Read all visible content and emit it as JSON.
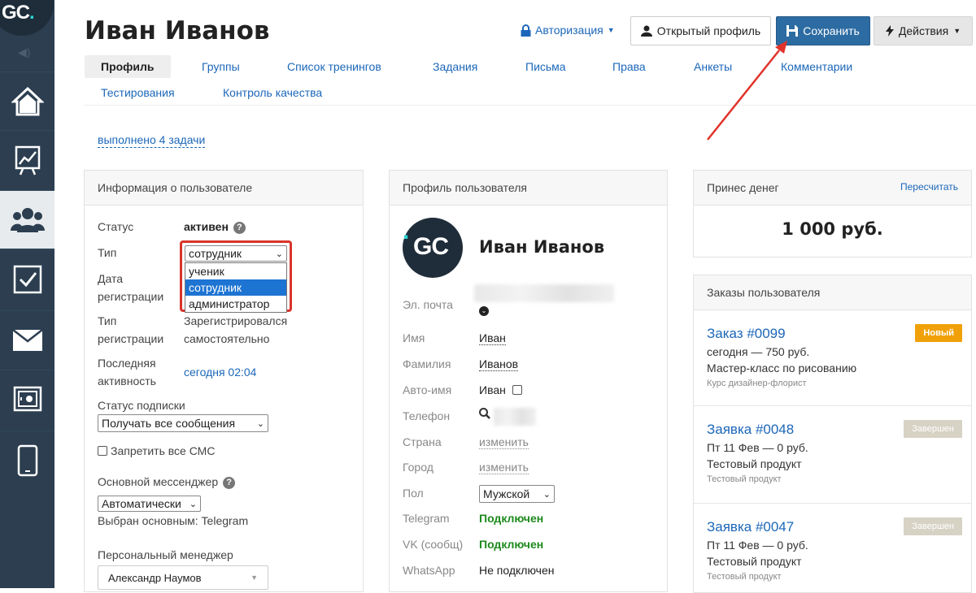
{
  "logo": {
    "text_g": "GC",
    "text_dot": "."
  },
  "header": {
    "title": "Иван Иванов",
    "auth_label": "Авторизация",
    "open_profile_label": "Открытый профиль",
    "save_label": "Сохранить",
    "actions_label": "Действия"
  },
  "tabs": [
    "Профиль",
    "Группы",
    "Список тренингов",
    "Задания",
    "Письма",
    "Права",
    "Анкеты",
    "Комментарии",
    "Тестирования",
    "Контроль качества"
  ],
  "tasks_done_link": "выполнено 4 задачи",
  "user_info": {
    "heading": "Информация о пользователе",
    "status_label": "Статус",
    "status_value": "активен",
    "type_label": "Тип",
    "type_value": "сотрудник",
    "type_options": [
      "ученик",
      "сотрудник",
      "администратор"
    ],
    "reg_date_label_1": "Дата",
    "reg_date_label_2": "регистрации",
    "reg_type_label_1": "Тип",
    "reg_type_label_2": "регистрации",
    "reg_type_value_1": "Зарегистрировался",
    "reg_type_value_2": "самостоятельно",
    "last_activity_label_1": "Последняя",
    "last_activity_label_2": "активность",
    "last_activity_value": "сегодня 02:04",
    "subscription_label": "Статус подписки",
    "subscription_value": "Получать все сообщения",
    "ban_sms_label": "Запретить все СМС",
    "messenger_label": "Основной мессенджер",
    "messenger_value": "Автоматически",
    "messenger_selected": "Выбран основным: Telegram",
    "manager_label": "Персональный менеджер",
    "manager_value": "Александр Наумов"
  },
  "profile": {
    "heading": "Профиль пользователя",
    "name": "Иван Иванов",
    "email_label": "Эл. почта",
    "first_name_label": "Имя",
    "first_name": "Иван",
    "last_name_label": "Фамилия",
    "last_name": "Иванов",
    "auto_name_label": "Авто-имя",
    "auto_name": "Иван",
    "phone_label": "Телефон",
    "country_label": "Страна",
    "country_value": "изменить",
    "city_label": "Город",
    "city_value": "изменить",
    "gender_label": "Пол",
    "gender_value": "Мужской",
    "telegram_label": "Telegram",
    "telegram_value": "Подключен",
    "vk_label": "VK (сообщ)",
    "vk_value": "Подключен",
    "whatsapp_label": "WhatsApp",
    "whatsapp_value": "Не подключен"
  },
  "money": {
    "heading": "Принес денег",
    "recalc": "Пересчитать",
    "amount": "1 000 руб."
  },
  "orders": {
    "heading": "Заказы пользователя",
    "items": [
      {
        "title": "Заказ #0099",
        "badge": "Новый",
        "line1": "сегодня — 750 руб.",
        "line2": "Мастер-класс по рисованию",
        "sub": "Курс дизайнер-флорист"
      },
      {
        "title": "Заявка #0048",
        "badge": "Завершен",
        "line1": "Пт 11 Фев — 0 руб.",
        "line2": "Тестовый продукт",
        "sub": "Тестовый продукт"
      },
      {
        "title": "Заявка #0047",
        "badge": "Завершен",
        "line1": "Пт 11 Фев — 0 руб.",
        "line2": "Тестовый продукт",
        "sub": "Тестовый продукт"
      }
    ]
  },
  "colors": {
    "accent": "#1c67b9",
    "save_button": "#2d6ca2",
    "badge_new": "#f0a10a",
    "highlight_frame": "#d9342b",
    "sidebar": "#2c3e50"
  }
}
